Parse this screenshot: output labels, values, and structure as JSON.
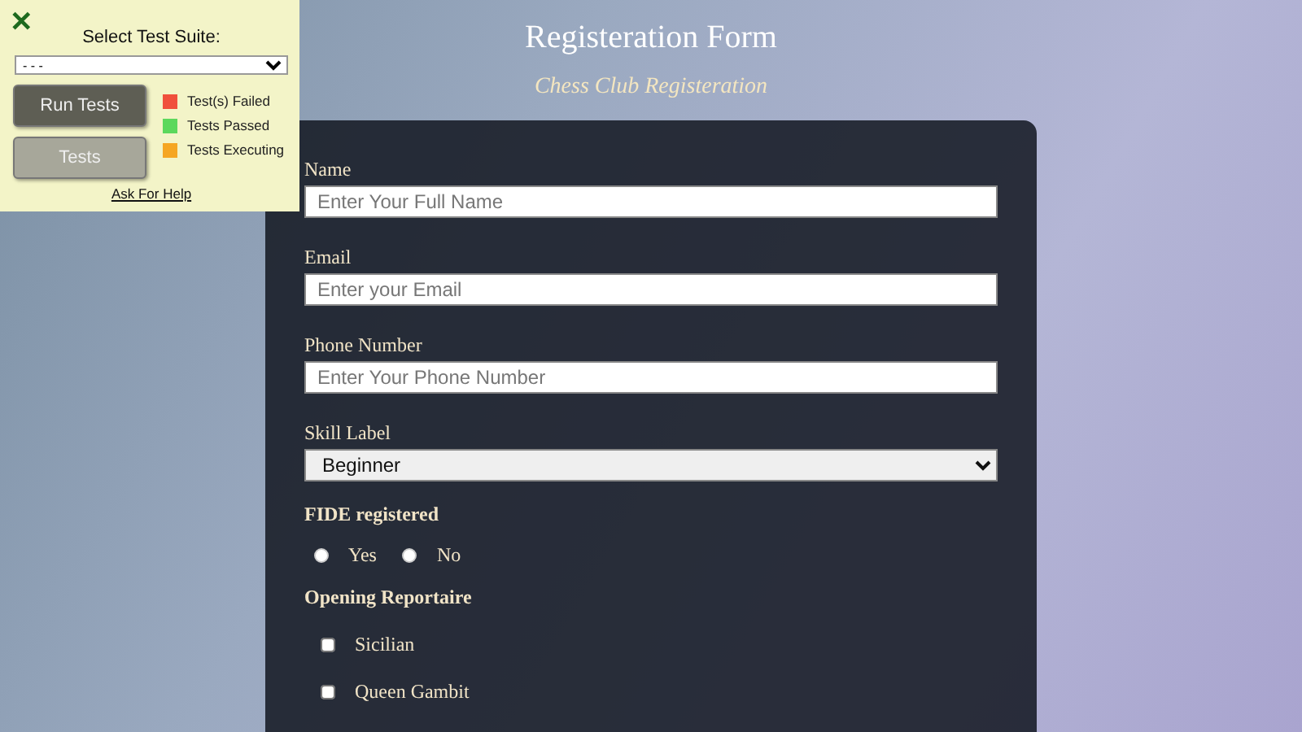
{
  "page": {
    "title": "Registeration Form",
    "subtitle": "Chess Club Registeration"
  },
  "form": {
    "fields": [
      {
        "kind": "text",
        "label": "Name",
        "placeholder": "Enter Your Full Name"
      },
      {
        "kind": "text",
        "label": "Email",
        "placeholder": "Enter your Email"
      },
      {
        "kind": "text",
        "label": "Phone Number",
        "placeholder": "Enter Your Phone Number"
      },
      {
        "kind": "select",
        "label": "Skill Label",
        "value": "Beginner"
      }
    ],
    "fide": {
      "label": "FIDE registered",
      "options": [
        {
          "label": "Yes",
          "selected": false
        },
        {
          "label": "No",
          "selected": false
        }
      ]
    },
    "openings": {
      "label": "Opening Reportaire",
      "options": [
        {
          "label": "Sicilian",
          "checked": false
        },
        {
          "label": "Queen Gambit",
          "checked": false
        }
      ]
    }
  },
  "test_panel": {
    "close": "✕",
    "label": "Select Test Suite:",
    "suite": "- - -",
    "buttons": [
      {
        "label": "Run Tests",
        "kind": "primary"
      },
      {
        "label": "Tests",
        "kind": "secondary"
      }
    ],
    "legend": [
      {
        "label": "Test(s) Failed",
        "color": "#f0503c"
      },
      {
        "label": "Tests Passed",
        "color": "#5cd85c"
      },
      {
        "label": "Tests Executing",
        "color": "#f5a623"
      }
    ],
    "help": "Ask For Help"
  }
}
